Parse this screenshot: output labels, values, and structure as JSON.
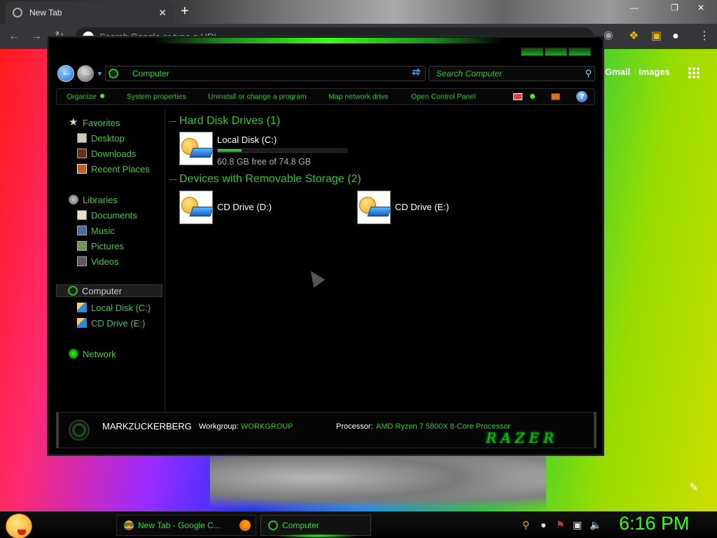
{
  "browser": {
    "tab_title": "New Tab",
    "tab_close": "✕",
    "new_tab": "+",
    "omnibox_placeholder": "Search Google or type a URL",
    "links": {
      "gmail": "Gmail",
      "images": "Images"
    },
    "window_controls": {
      "minimize": "—",
      "maximize": "❐",
      "close": "✕"
    }
  },
  "explorer": {
    "address": "Computer",
    "search_placeholder": "Search Computer",
    "commands": {
      "organize": "Organize",
      "system_properties": "System properties",
      "uninstall": "Uninstall or change a program",
      "map_drive": "Map network drive",
      "control_panel": "Open Control Panel",
      "help": "?"
    },
    "nav": {
      "favorites": "Favorites",
      "desktop": "Desktop",
      "downloads": "Downloads",
      "recent_places": "Recent Places",
      "libraries": "Libraries",
      "documents": "Documents",
      "music": "Music",
      "pictures": "Pictures",
      "videos": "Videos",
      "computer": "Computer",
      "local_disk": "Local Disk (C:)",
      "cd_drive": "CD Drive (E:)",
      "network": "Network"
    },
    "groups": {
      "hdd": "Hard Disk Drives (1)",
      "removable": "Devices with Removable Storage (2)"
    },
    "drives": {
      "c": {
        "name": "Local Disk (C:)",
        "free": "60.8 GB free of 74.8 GB",
        "used_fraction": 0.187
      },
      "d": {
        "name": "CD Drive (D:)"
      },
      "e": {
        "name": "CD Drive (E:)"
      }
    },
    "details": {
      "pc_name": "MARKZUCKERBERG",
      "workgroup_label": "Workgroup:",
      "workgroup": "WORKGROUP",
      "processor_label": "Processor:",
      "processor": "AMD Ryzen 7 5800X 8-Core Processor",
      "brand": "RAZER"
    }
  },
  "taskbar": {
    "chrome": "New Tab - Google C...",
    "computer": "Computer",
    "clock": "6:16 PM"
  },
  "colors": {
    "accent": "#39ff14",
    "text_green": "#31c631"
  }
}
